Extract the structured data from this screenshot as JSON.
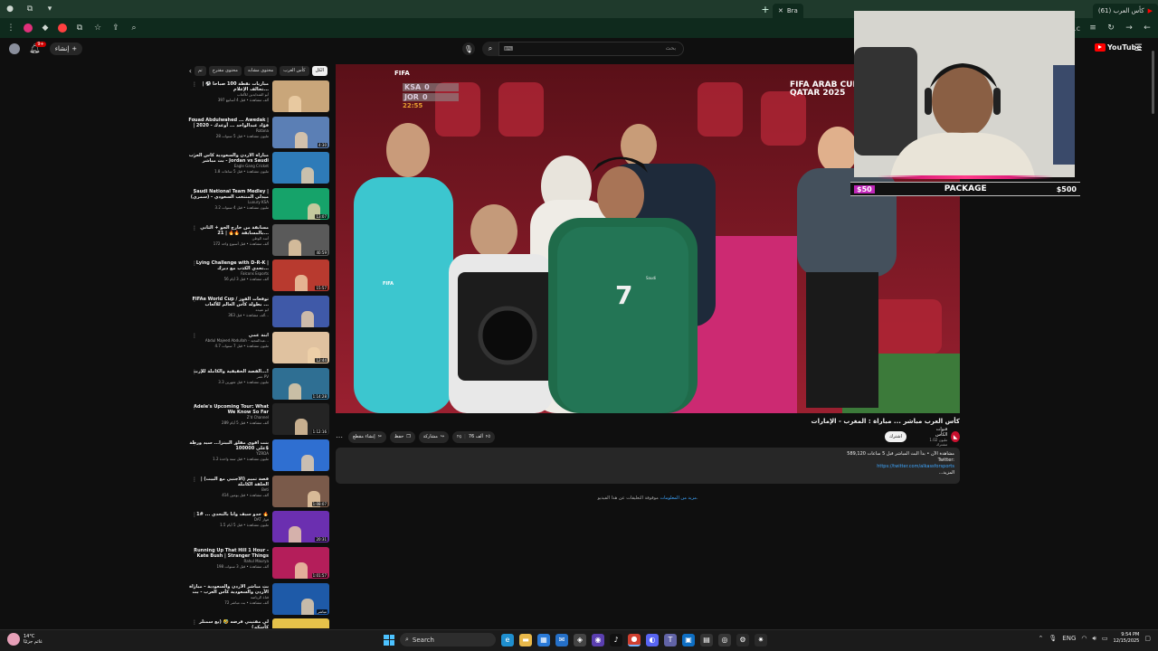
{
  "browser": {
    "tab_title": "Bra",
    "tab_title_2": "(61) كأس العرب",
    "address": "1c",
    "colors": {
      "chrome": "#1f3a2c",
      "toolbar": "#0f2a1d"
    }
  },
  "header": {
    "create_label": "إنشاء",
    "notification_count": "9+",
    "search_placeholder": "بحث",
    "logo_text": "YouTube",
    "logo_region": "BH"
  },
  "chips": [
    "الكل",
    "كأس العرب",
    "محتوى مشابه",
    "محتوى مقترح",
    "تم"
  ],
  "recommendations": [
    {
      "title": "مباريات نقطة 100 صباحاً ⚽ | تحالف الإعلام...",
      "channel": "أبو الشدايدين للألعاب",
      "stats": "397 ألف مشاهدة • قبل 4 أسابيع",
      "duration": "",
      "thumb": "#c9a67a"
    },
    {
      "title": "Fouad Abdulwahed ... Awedak | فؤاد عبدالواحد ... أوعدك - 2020 | جابر...",
      "channel": "Rotana",
      "stats": "28 مليون مشاهدة • قبل 5 سنوات",
      "duration": "4:30",
      "thumb": "#5b7fb5"
    },
    {
      "title": "مباراة الأردن والسعودية كأس العرب - بث مباشر Jordan vs Saudi Arabia |",
      "channel": "Eagle Gang Cricket",
      "stats": "1.8 مليون مشاهدة • قبل 5 ساعات",
      "duration": "",
      "thumb": "#2e7bb8"
    },
    {
      "title": "Saudi National Team Medley | ميدلي المنتخب السعودي - (سمري)",
      "channel": "Luxury KSA",
      "stats": "3.2 مليون مشاهدة • قبل 4 سنوات",
      "duration": "13:07",
      "thumb": "#16a36a"
    },
    {
      "title": "مسابقة من خارج الجو + الثاني بالمسابقة 🔥🔥 | 21...",
      "channel": "أسد الوطن",
      "stats": "172 ألف مشاهدة • قبل أسبوع واحد",
      "duration": "40:59",
      "thumb": "#5a5a5a"
    },
    {
      "title": "Lying Challenge with D-R-K | تحدي الكذب مع ديرك...",
      "channel": "Falcons Esports",
      "stats": "56 ألف مشاهدة • قبل 3 أيام",
      "duration": "15:57",
      "thumb": "#b83a2f"
    },
    {
      "title": "FIFAe World Cup / توقعات الفوز ... بطولة كأس العالم للألعاب",
      "channel": "ابو عبيده",
      "stats": "363 ألف مشاهدة • قبل...",
      "duration": "",
      "thumb": "#3f59a8"
    },
    {
      "title": "ابنة عمي",
      "channel": "Abdul Majeed Abdullah - عبدالمجيد...",
      "stats": "4.7 مليون مشاهدة • قبل 7 سنوات",
      "duration": "12:44",
      "thumb": "#e0c2a0"
    },
    {
      "title": "القصة الحقيقية والكاملة للإرث...!",
      "channel": "عمر PV",
      "stats": "3.3 مليون مشاهدة • قبل شهرين",
      "duration": "1:14:28",
      "thumb": "#2f6f93"
    },
    {
      "title": "Adele's Upcoming Tour: What We Know So Far",
      "channel": "Z'd Channel",
      "stats": "289 ألف مشاهدة • قبل 5 أيام",
      "duration": "1:12:16",
      "thumb": "#242424"
    },
    {
      "title": "بنت أقوى مقلق البيتزا... سيد ورطة علي 100000$",
      "channel": "YZRDA",
      "stats": "1.2 مليون مشاهدة • قبل سنة واحدة",
      "duration": "",
      "thumb": "#2f6fd1"
    },
    {
      "title": "قصة تميم (الأجنبي مع البيت) | الحلقة الكاملة",
      "channel": "Beti",
      "stats": "414 ألف مشاهدة • قبل يومين",
      "duration": "1:08:07",
      "thumb": "#7a5a4a"
    },
    {
      "title": "جدو سيف وأنا بالتحدي ... #1 🔥",
      "channel": "DAT فواز",
      "stats": "1.5 مليون مشاهدة • قبل 5 أيام",
      "duration": "20:31",
      "thumb": "#6b2fb0"
    },
    {
      "title": "Running Up That Hill 1 Hour - Kate Bush | Stranger Things",
      "channel": "Rahul Maurya",
      "stats": "198 ألف مشاهدة • قبل 3 سنوات",
      "duration": "1:01:57",
      "thumb": "#b41e5a"
    },
    {
      "title": "بث مباشر الأردن والسعودية - مباراة الأردن والسعودية كأس العرب - بث مباشر",
      "channel": "قناة الرياضة",
      "stats": "72 ألف مشاهدة • بث مباشر",
      "duration": "مباشر",
      "thumb": "#1e5aa8"
    },
    {
      "title": "لي مفتيني قرضه 🤣 (يع سمتلر كأسكم)",
      "channel": "اخت الكلبي",
      "stats": "",
      "duration": "",
      "thumb": "#e6c24a"
    }
  ],
  "player": {
    "score_home": "KSA",
    "score_away": "JOR",
    "score_home_val": "0",
    "score_away_val": "0",
    "time": "22:55",
    "fifa": "FIFA",
    "tournament_line1": "FIFA ARAB CUP",
    "tournament_line2": "QATAR 2025",
    "ref_text": "FIFA",
    "jersey_number": "7",
    "jersey_crest": "Saudi"
  },
  "video": {
    "title": "كأس العرب مباشر ... مباراة : المغرب - الإمارات",
    "channel_name": "قنوات الكأس",
    "channel_subs": "1.02 مليون مشترك",
    "subscribe": "اشترك",
    "like_count": "76 ألف",
    "share": "مشاركة",
    "download": "تنزيل",
    "clip": "إنشاء مقطع",
    "save": "حفظ",
    "description": [
      "589,120 مشاهدة الآن • بدأ البث المباشر قبل 5 ساعات",
      "Twitter:"
    ],
    "description_link": "https://twitter.com/alkassforsports",
    "description_more": "...المزيد",
    "comments_text": "موقوفة التعليقات عن هذا الفيديو.",
    "comments_link": "مزيد من المعلومات"
  },
  "webcam": {
    "left_amount": "$50",
    "center_label": "PACKAGE",
    "right_amount": "$500",
    "accent": "#c026b8"
  },
  "taskbar": {
    "weather_temp": "14°C",
    "weather_desc": "غائم جزئيًا",
    "search_label": "Search",
    "lang": "ENG",
    "time": "9:54 PM",
    "date": "12/15/2025"
  }
}
